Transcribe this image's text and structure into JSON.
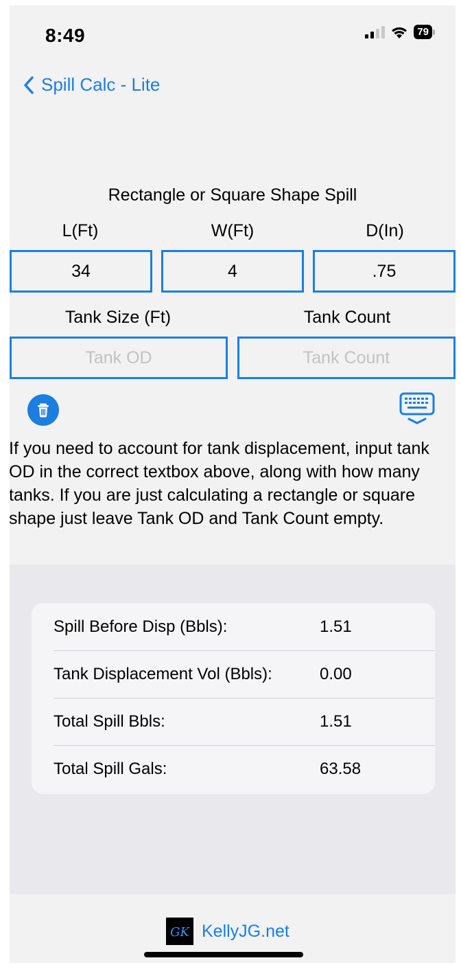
{
  "status_bar": {
    "time": "8:49",
    "battery": "79"
  },
  "nav": {
    "back_label": "Spill Calc - Lite"
  },
  "form": {
    "title": "Rectangle or Square Shape Spill",
    "length_label": "L(Ft)",
    "width_label": "W(Ft)",
    "depth_label": "D(In)",
    "length_value": "34",
    "width_value": "4",
    "depth_value": ".75",
    "tank_size_label": "Tank Size (Ft)",
    "tank_count_label": "Tank Count",
    "tank_od_placeholder": "Tank OD",
    "tank_count_placeholder": "Tank Count",
    "tank_od_value": "",
    "tank_count_value": ""
  },
  "icons": {
    "clear": "trash-icon",
    "keyboard": "keyboard-icon",
    "back": "chevron-left-icon"
  },
  "help_text": "If you need to account for tank displacement, input tank OD in the correct textbox above, along with how many tanks.  If you are just calculating a rectangle or square shape just leave Tank OD and Tank Count empty.",
  "results": [
    {
      "label": "Spill Before Disp (Bbls):",
      "value": "1.51"
    },
    {
      "label": "Tank Displacement Vol (Bbls):",
      "value": "0.00"
    },
    {
      "label": "Total Spill Bbls:",
      "value": "1.51"
    },
    {
      "label": "Total Spill Gals:",
      "value": "63.58"
    }
  ],
  "footer": {
    "logo_text": "GK",
    "link": "KellyJG.net"
  },
  "colors": {
    "accent": "#1a7fe0",
    "background": "#f2f2f2",
    "results_bg": "#e8e8ed"
  }
}
